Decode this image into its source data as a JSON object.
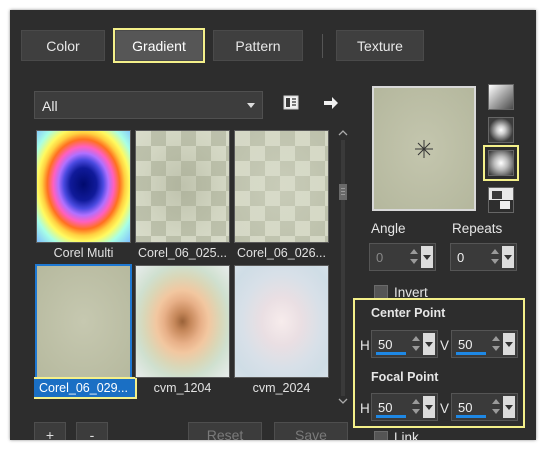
{
  "tabs": [
    {
      "label": "Color",
      "active": false
    },
    {
      "label": "Gradient",
      "active": true
    },
    {
      "label": "Pattern",
      "active": false
    },
    {
      "label": "Texture",
      "active": false
    }
  ],
  "category_dropdown": {
    "selected": "All"
  },
  "toolbar_icons": [
    "library-icon",
    "arrow-right-icon"
  ],
  "thumbnails": [
    {
      "label": "Corel Multi",
      "selected": false
    },
    {
      "label": "Corel_06_025...",
      "selected": false
    },
    {
      "label": "Corel_06_026...",
      "selected": false
    },
    {
      "label": "Corel_06_029...",
      "selected": true
    },
    {
      "label": "cvm_1204",
      "selected": false
    },
    {
      "label": "cvm_2024",
      "selected": false
    }
  ],
  "angle": {
    "label": "Angle",
    "value": "0"
  },
  "repeats": {
    "label": "Repeats",
    "value": "0"
  },
  "invert": {
    "label": "Invert",
    "checked": false
  },
  "center_point": {
    "title": "Center Point",
    "h_label": "H",
    "h_value": "50",
    "v_label": "V",
    "v_value": "50"
  },
  "focal_point": {
    "title": "Focal Point",
    "h_label": "H",
    "h_value": "50",
    "v_label": "V",
    "v_value": "50"
  },
  "link": {
    "label": "Link"
  },
  "bottom_buttons": {
    "add": "+",
    "remove": "-",
    "reset": "Reset",
    "save": "Save"
  },
  "gradient_styles": [
    "linear",
    "rectangular",
    "radial",
    "corner"
  ],
  "colors": {
    "highlight": "#f4f08a",
    "selection": "#1a6fc4"
  }
}
